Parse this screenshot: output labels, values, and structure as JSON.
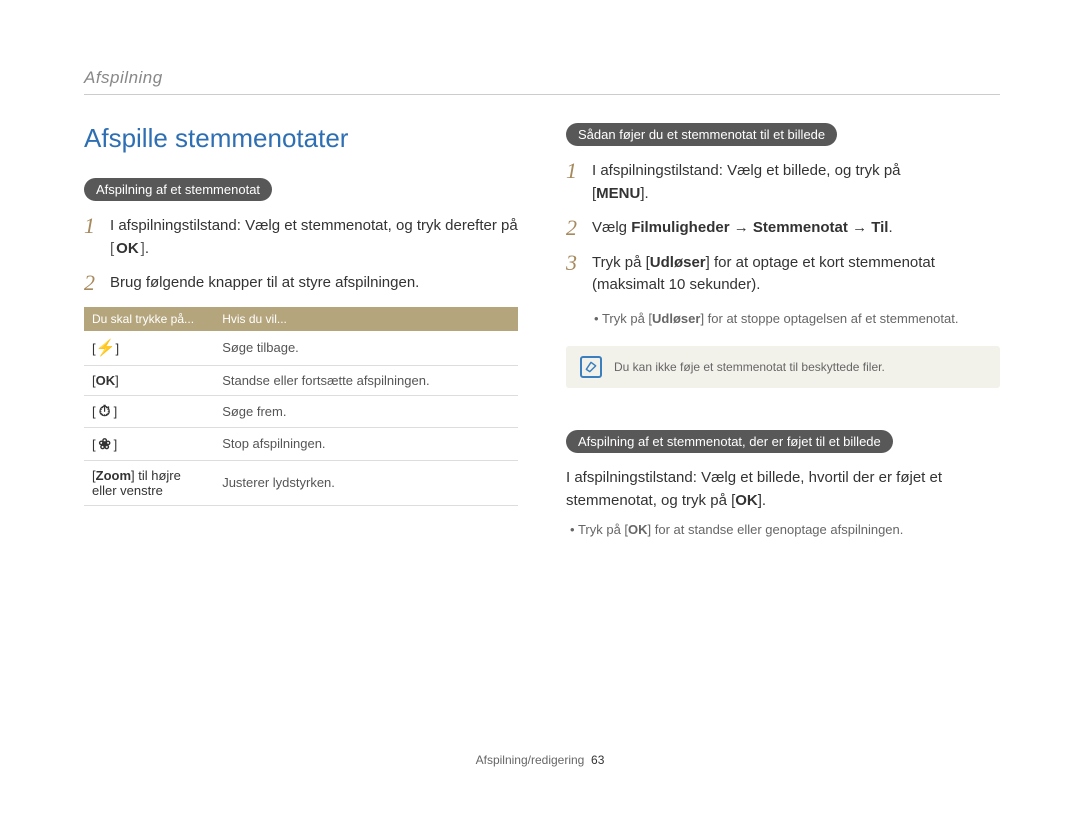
{
  "breadcrumb": "Afspilning",
  "title": "Afspille stemmenotater",
  "left": {
    "pill": "Afspilning af et stemmenotat",
    "step1_a": "I afspilningstilstand: Vælg et stemmenotat, og tryk derefter på ",
    "ok": "OK",
    "step1_b": ".",
    "step2": "Brug følgende knapper til at styre afspilningen.",
    "th1": "Du skal trykke på...",
    "th2": "Hvis du vil...",
    "rows": [
      {
        "key_pre": "[",
        "key_icon": "flash",
        "key_post": "]",
        "val": "Søge tilbage."
      },
      {
        "key_pre": "[",
        "key_icon": "ok",
        "key_post": "]",
        "val": "Standse eller fortsætte afspilningen."
      },
      {
        "key_pre": "[",
        "key_icon": "timer",
        "key_post": "]",
        "val": "Søge frem."
      },
      {
        "key_pre": "[",
        "key_icon": "flower",
        "key_post": "]",
        "val": "Stop afspilningen."
      }
    ],
    "row_zoom_key_a": "[",
    "row_zoom_bold": "Zoom",
    "row_zoom_key_b": "] til højre eller venstre",
    "row_zoom_val": "Justerer lydstyrken."
  },
  "right": {
    "pill1": "Sådan føjer du et stemmenotat til et billede",
    "step1_a": "I afspilningstilstand: Vælg et billede, og tryk på ",
    "menu_pre": "[",
    "menu": "MENU",
    "menu_post": "].",
    "step2_a": "Vælg ",
    "step2_b": "Filmuligheder",
    "step2_arrow1": " → ",
    "step2_c": "Stemmenotat",
    "step2_arrow2": " → ",
    "step2_d": "Til",
    "step2_e": ".",
    "step3_a": "Tryk på [",
    "step3_b": "Udløser",
    "step3_c": "] for at optage et kort stemmenotat (maksimalt 10 sekunder).",
    "bullet_a": "Tryk på [",
    "bullet_b": "Udløser",
    "bullet_c": "] for at stoppe optagelsen af et stemmenotat.",
    "note": "Du kan ikke føje et stemmenotat til beskyttede filer.",
    "pill2": "Afspilning af et stemmenotat, der er føjet til et billede",
    "para_a": "I afspilningstilstand: Vælg et billede, hvortil der er føjet et stemmenotat, og tryk på [",
    "para_ok": "OK",
    "para_b": "].",
    "bullet2_a": "Tryk på [",
    "bullet2_ok": "OK",
    "bullet2_b": "] for at standse eller genoptage afspilningen."
  },
  "footer": {
    "label": "Afspilning/redigering",
    "page": "63"
  }
}
